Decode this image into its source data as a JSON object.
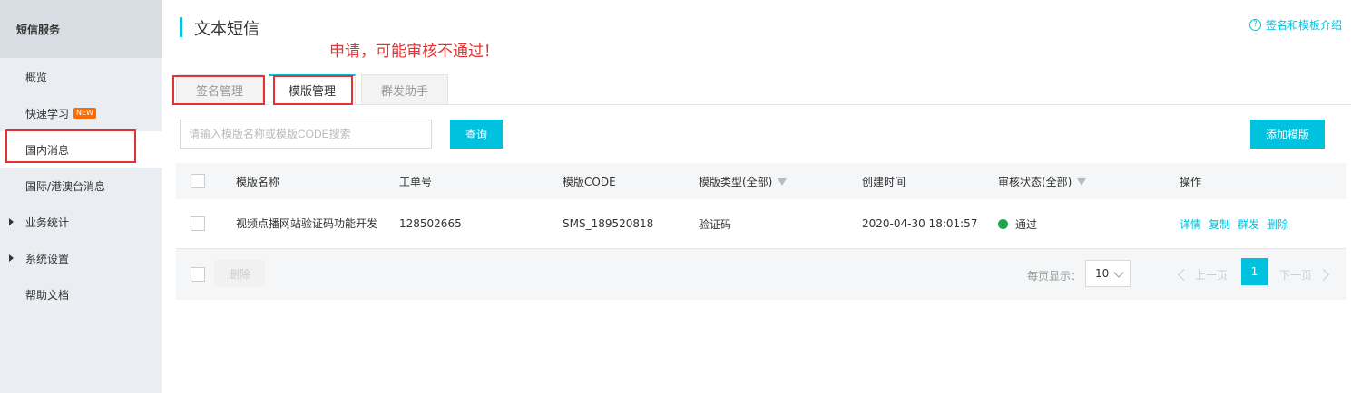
{
  "sidebar": {
    "title": "短信服务",
    "items": [
      {
        "label": "概览"
      },
      {
        "label": "快速学习",
        "badge": "NEW"
      },
      {
        "label": "国内消息"
      },
      {
        "label": "国际/港澳台消息"
      },
      {
        "label": "业务统计"
      },
      {
        "label": "系统设置"
      },
      {
        "label": "帮助文档"
      }
    ]
  },
  "header": {
    "title": "文本短信",
    "help_link": "签名和模板介绍",
    "help_icon_glyph": "?"
  },
  "annotation": "申请，可能审核不通过！",
  "tabs": [
    {
      "label": "签名管理"
    },
    {
      "label": "模版管理"
    },
    {
      "label": "群发助手"
    }
  ],
  "toolbar": {
    "search_placeholder": "请输入模版名称或模版CODE搜索",
    "query_label": "查询",
    "add_template_label": "添加模版"
  },
  "table": {
    "columns": [
      "模版名称",
      "工单号",
      "模版CODE",
      "模版类型(全部)",
      "创建时间",
      "审核状态(全部)",
      "操作"
    ],
    "rows": [
      {
        "name": "视频点播网站验证码功能开发",
        "order_no": "128502665",
        "code": "SMS_189520818",
        "type": "验证码",
        "created": "2020-04-30 18:01:57",
        "status": "通过",
        "status_color": "#1ea64a",
        "actions": [
          "详情",
          "复制",
          "群发",
          "删除"
        ]
      }
    ]
  },
  "footer": {
    "delete_label": "删除",
    "page_size_label": "每页显示：",
    "page_size_value": "10",
    "prev_label": "上一页",
    "next_label": "下一页",
    "current_page": "1"
  },
  "colors": {
    "accent": "#00c1de",
    "annotation": "#e23232",
    "badge": "#ff6a00"
  }
}
